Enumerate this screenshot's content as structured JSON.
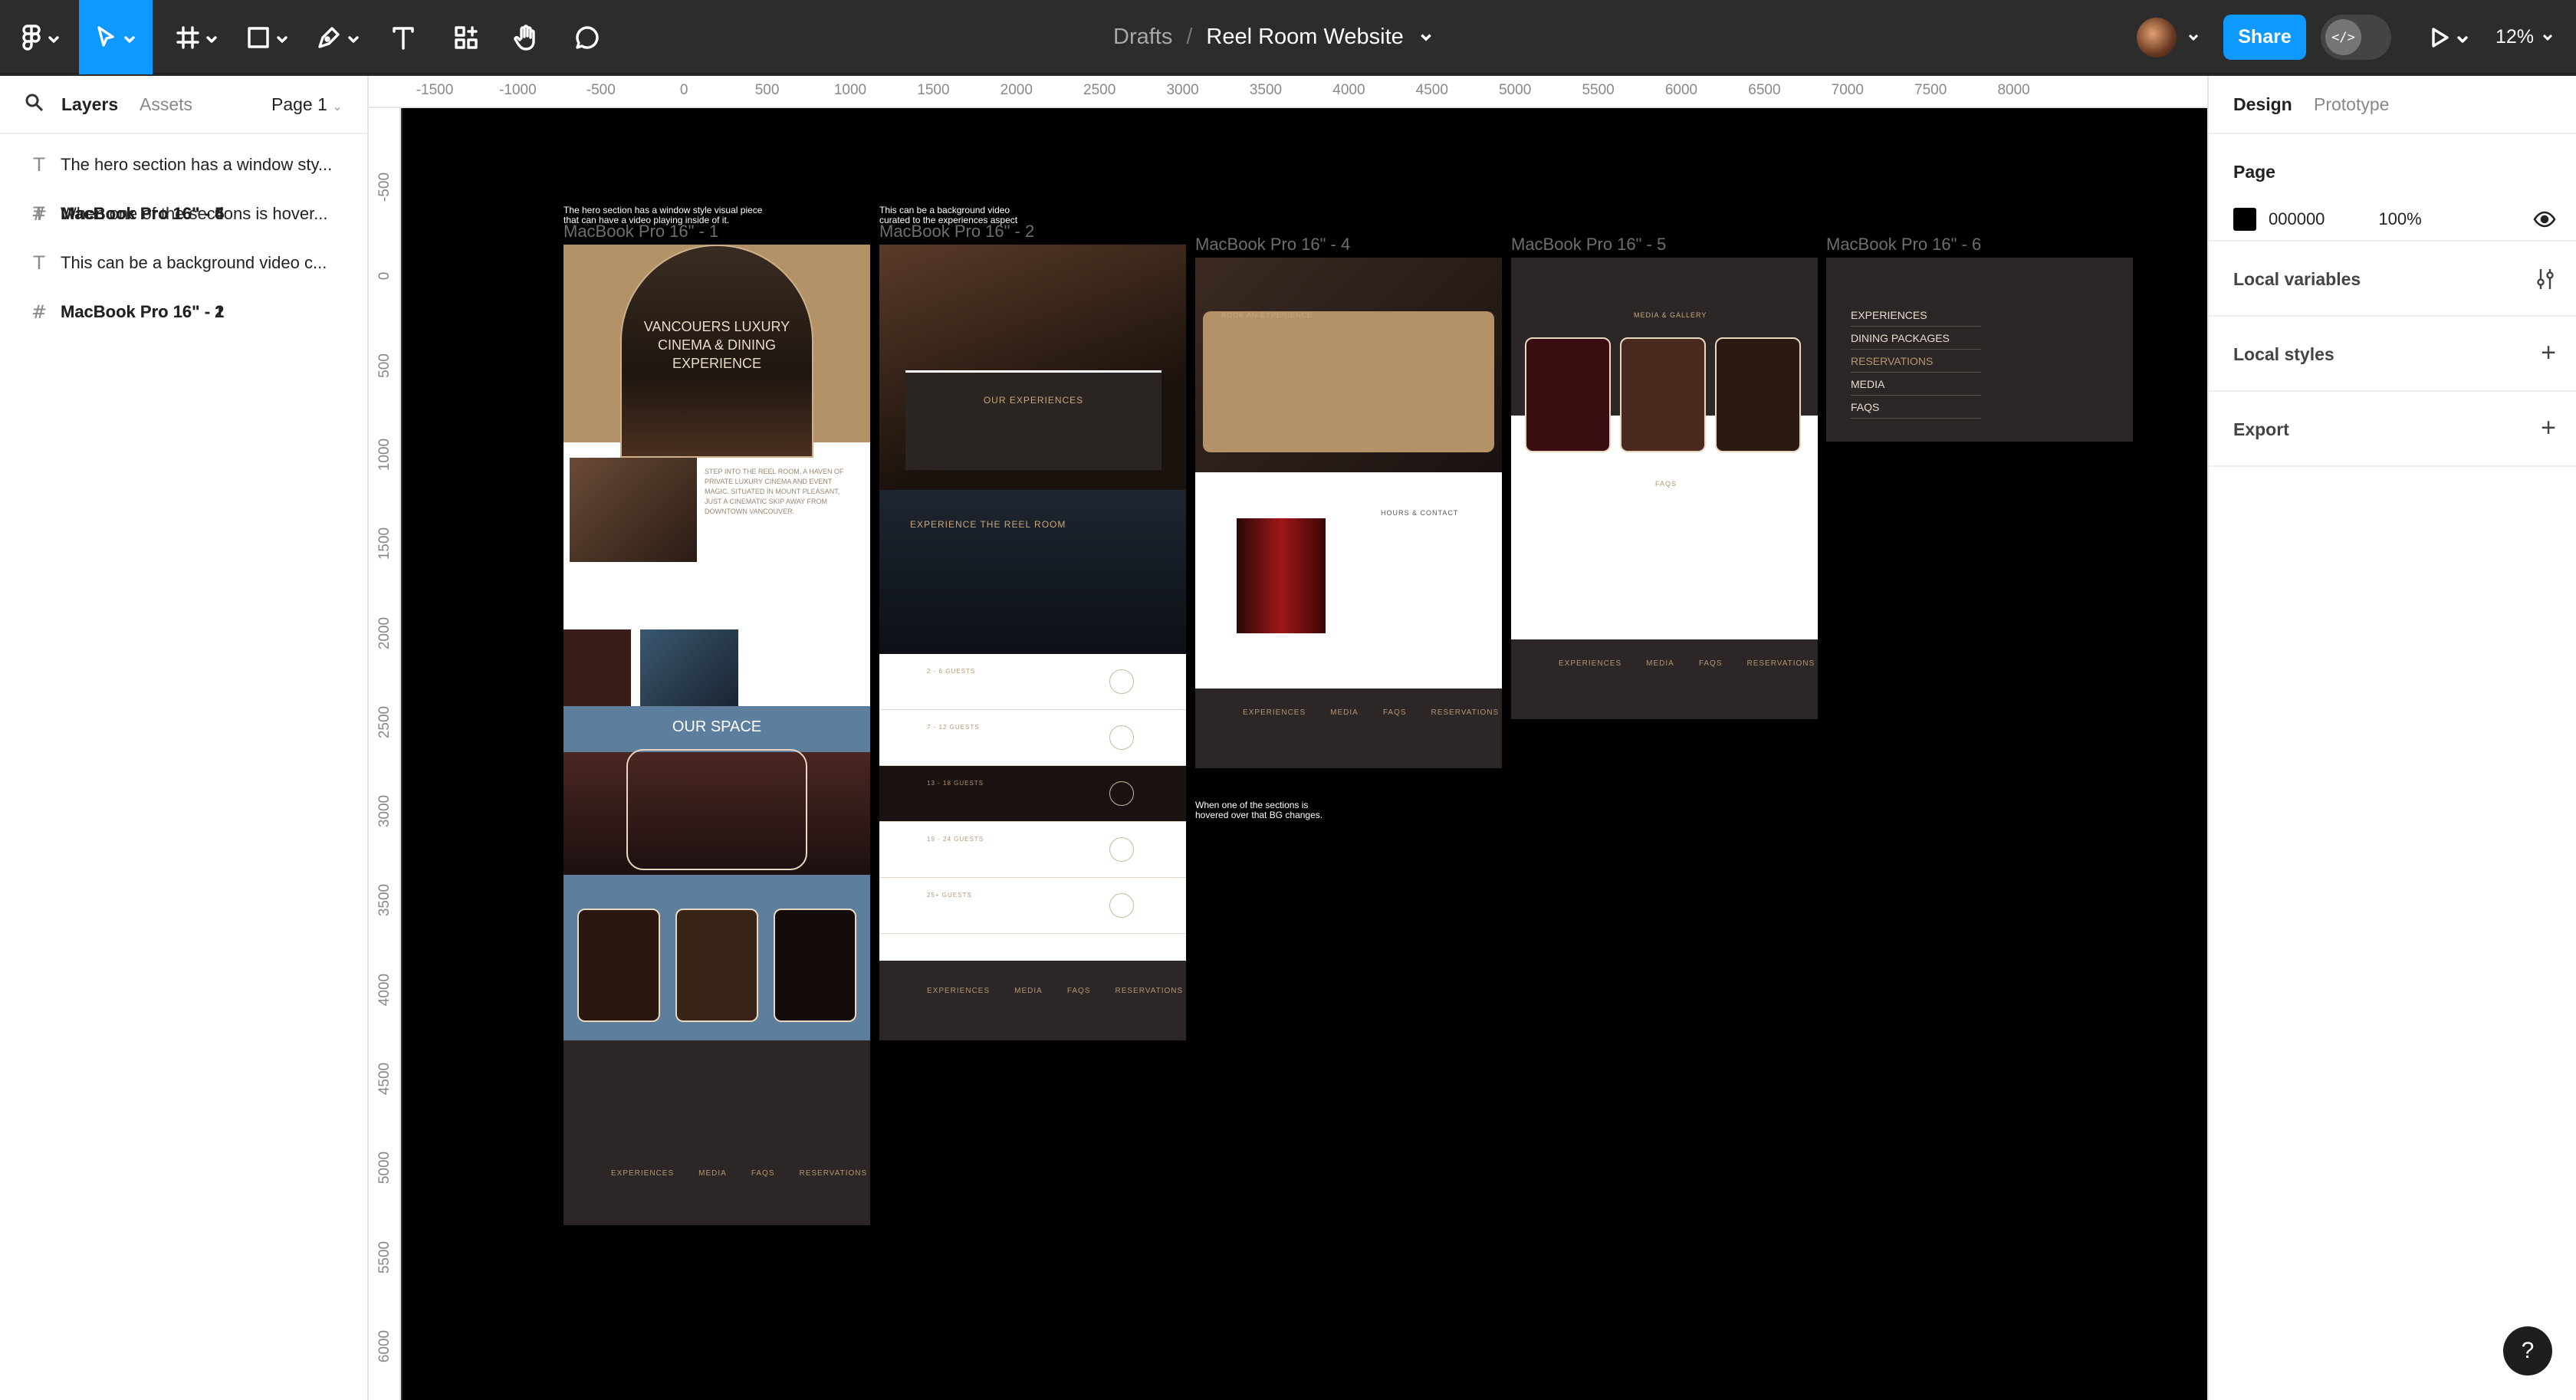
{
  "toolbar": {
    "breadcrumb_drafts": "Drafts",
    "breadcrumb_sep": "/",
    "file_name": "Reel Room Website",
    "share_label": "Share",
    "devmode_label": "</>",
    "zoom_label": "12%"
  },
  "left_panel": {
    "tab_layers": "Layers",
    "tab_assets": "Assets",
    "page_select": "Page 1",
    "layers": [
      {
        "type": "text",
        "label": "The hero section has a window sty..."
      },
      {
        "type": "frame",
        "label": "MacBook Pro 16\" - 5"
      },
      {
        "type": "frame",
        "label": "MacBook Pro 16\" - 4"
      },
      {
        "type": "frame",
        "label": "MacBook Pro 16\" - 6"
      },
      {
        "type": "text",
        "label": "When one of the sections is hover..."
      },
      {
        "type": "text",
        "label": "This can be a background video c..."
      },
      {
        "type": "frame",
        "label": "MacBook Pro 16\" - 2"
      },
      {
        "type": "frame",
        "label": "MacBook Pro 16\" - 1"
      }
    ]
  },
  "right_panel": {
    "tab_design": "Design",
    "tab_prototype": "Prototype",
    "page_title": "Page",
    "page_color": "000000",
    "page_opacity": "100%",
    "local_variables": "Local variables",
    "local_styles": "Local styles",
    "export": "Export",
    "help": "?"
  },
  "rulers": {
    "top": [
      "-1500",
      "-1000",
      "-500",
      "0",
      "500",
      "1000",
      "1500",
      "2000",
      "2500",
      "3000",
      "3500",
      "4000",
      "4500",
      "5000",
      "5500",
      "6000",
      "6500",
      "7000",
      "7500",
      "8000"
    ],
    "left": [
      "-500",
      "0",
      "500",
      "1000",
      "1500",
      "2000",
      "2500",
      "3000",
      "3500",
      "4000",
      "4500",
      "5000",
      "5500",
      "6000"
    ]
  },
  "canvas": {
    "frames": {
      "f1": "MacBook Pro 16\" - 1",
      "f2": "MacBook Pro 16\" - 2",
      "f4": "MacBook Pro 16\" - 4",
      "f5": "MacBook Pro 16\" - 5",
      "f6": "MacBook Pro 16\" - 6"
    },
    "notes": {
      "hero": "The hero section has a window style visual piece that can have a video playing inside of it.",
      "bgvideo": "This can be a background video curated to the experiences aspect",
      "hover": "When one of the sections is hovered over that BG changes."
    },
    "f1_content": {
      "hero_title": "VANCOUERS LUXURY CINEMA & DINING EXPERIENCE",
      "intro": "STEP INTO THE REEL ROOM, A HAVEN OF PRIVATE LUXURY CINEMA AND EVENT MAGIC. SITUATED IN MOUNT PLEASANT, JUST A CINEMATIC SKIP AWAY FROM DOWNTOWN VANCOUVER.",
      "our_space": "OUR SPACE"
    },
    "f2_content": {
      "our_experiences": "OUR EXPERIENCES",
      "experience_title": "EXPERIENCE THE REEL ROOM",
      "guest_tiers": [
        "2 - 6 GUESTS",
        "7 - 12 GUESTS",
        "13 - 18 GUESTS",
        "19 - 24 GUESTS",
        "25+ GUESTS"
      ]
    },
    "f4_content": {
      "book": "BOOK AN EXPERIENCE",
      "hours": "HOURS & CONTACT"
    },
    "f5_content": {
      "media": "MEDIA & GALLERY",
      "faqs": "FAQS"
    },
    "f6_menu": [
      "EXPERIENCES",
      "DINING PACKAGES",
      "RESERVATIONS",
      "MEDIA",
      "FAQS"
    ],
    "footer_links": [
      "EXPERIENCES",
      "MEDIA",
      "FAQS",
      "RESERVATIONS"
    ]
  }
}
